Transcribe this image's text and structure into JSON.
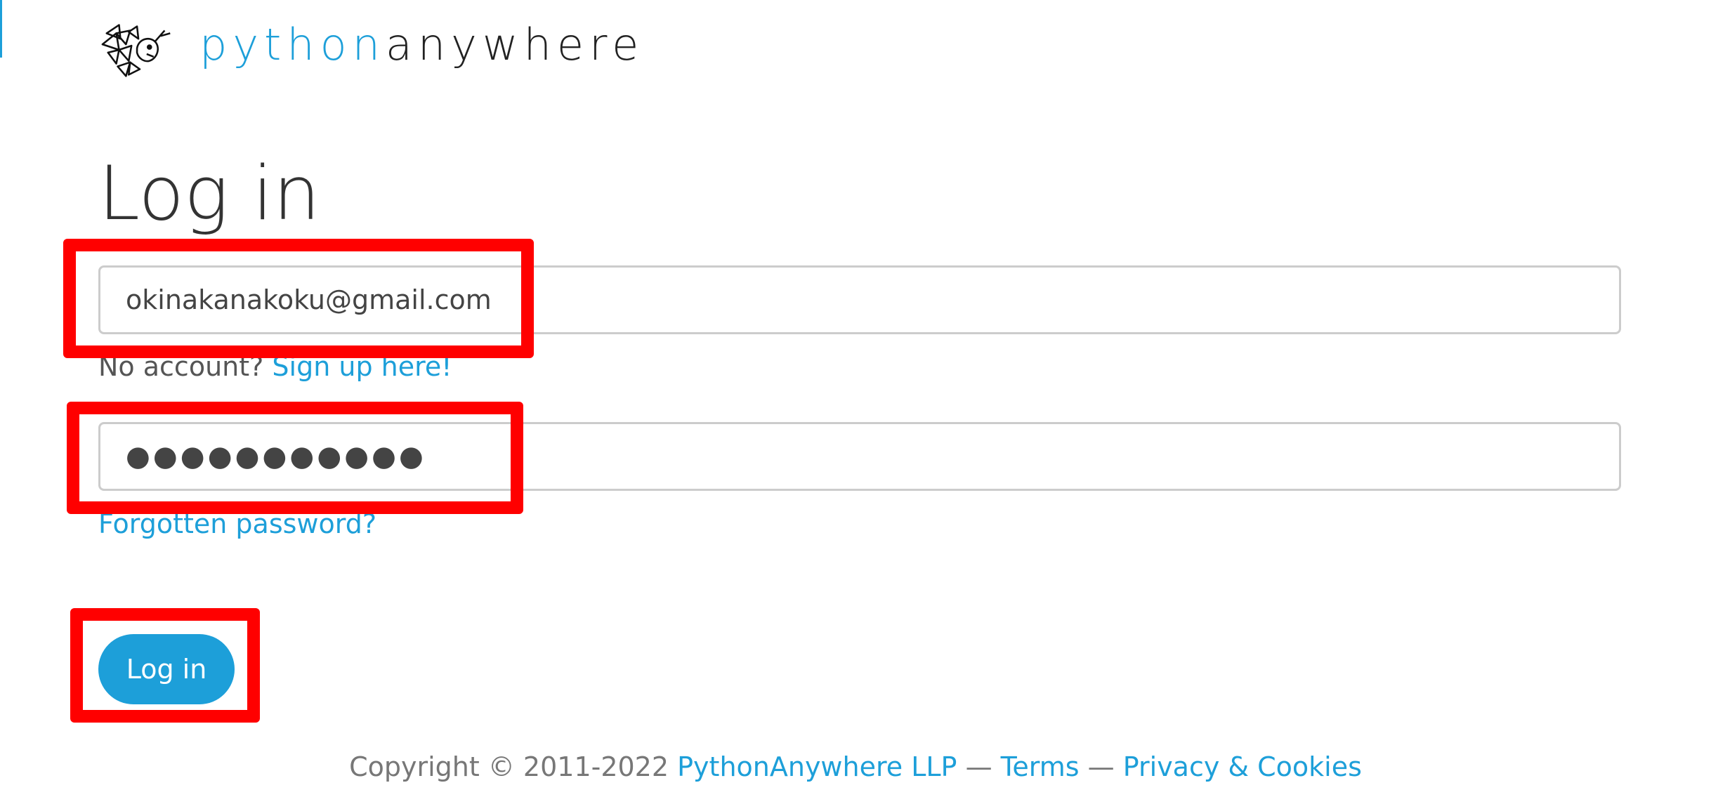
{
  "brand": {
    "logo_part1": "python",
    "logo_part2": "anywhere",
    "accent_color": "#1d9fd9",
    "logo_icon": "pythonanywhere-logo-icon"
  },
  "login": {
    "title": "Log in",
    "username_value": "okinakanakoku@gmail.com",
    "password_value": "●●●●●●●●●●●",
    "no_account_text": "No account?",
    "signup_link": "Sign up here!",
    "forgot_link": "Forgotten password?",
    "submit_label": "Log in"
  },
  "footer": {
    "copyright": "Copyright © 2011-2022",
    "company_link": "PythonAnywhere LLP",
    "separator": "—",
    "terms_link": "Terms",
    "privacy_link": "Privacy & Cookies"
  },
  "annotation_color": "#ff0000"
}
